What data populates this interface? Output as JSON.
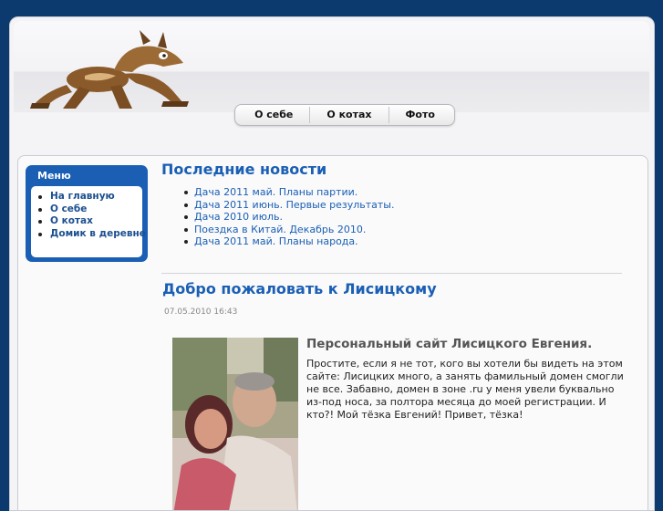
{
  "header": {
    "logo": "coyote-logo",
    "nav": [
      "О себе",
      "О котах",
      "Фото"
    ]
  },
  "sidebar": {
    "title": "Меню",
    "items": [
      "На главную",
      "О себе",
      "О котах",
      "Домик в деревне"
    ]
  },
  "news": {
    "heading": "Последние новости",
    "items": [
      "Дача 2011 май. Планы партии.",
      "Дача 2011 июнь. Первые результаты.",
      "Дача 2010 июль.",
      "Поездка в Китай. Декабрь 2010.",
      "Дача 2011 май. Планы народа."
    ]
  },
  "article": {
    "title": "Добро пожаловать к Лисицкому",
    "date": "07.05.2010 16:43",
    "subtitle": "Персональный сайт Лисицкого Евгения.",
    "body": "Простите, если я не тот, кого вы хотели бы видеть на этом сайте: Лисицких много, а занять фамильный домен смогли не все. Забавно, домен в зоне .ru у меня увели буквально из-под носа, за полтора месяца до моей регистрации. И кто?! Мой тёзка Евгений! Привет, тёзка!"
  },
  "colors": {
    "background": "#0c3a6e",
    "accent": "#1a5fb4"
  }
}
